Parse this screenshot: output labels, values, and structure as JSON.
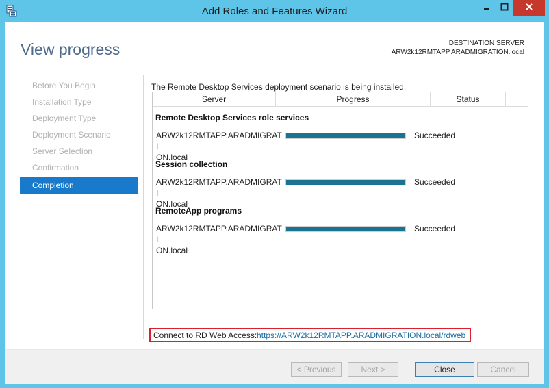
{
  "window": {
    "title": "Add Roles and Features Wizard",
    "icons": [
      "server-manager-icon",
      "minimize-icon",
      "maximize-icon",
      "close-icon"
    ]
  },
  "header": {
    "heading": "View progress",
    "destination_label": "DESTINATION SERVER",
    "destination_server": "ARW2k12RMTAPP.ARADMIGRATION.local"
  },
  "nav": {
    "steps": [
      {
        "label": "Before You Begin",
        "active": false
      },
      {
        "label": "Installation Type",
        "active": false
      },
      {
        "label": "Deployment Type",
        "active": false
      },
      {
        "label": "Deployment Scenario",
        "active": false
      },
      {
        "label": "Server Selection",
        "active": false
      },
      {
        "label": "Confirmation",
        "active": false
      },
      {
        "label": "Completion",
        "active": true
      }
    ]
  },
  "main": {
    "intro": "The Remote Desktop Services deployment scenario is being installed.",
    "columns": {
      "server": "Server",
      "progress": "Progress",
      "status": "Status"
    },
    "groups": [
      {
        "title": "Remote Desktop Services role services",
        "server_line1": "ARW2k12RMTAPP.ARADMIGRATI",
        "server_line2": "ON.local",
        "progress": 1.0,
        "status": "Succeeded"
      },
      {
        "title": "Session collection",
        "server_line1": "ARW2k12RMTAPP.ARADMIGRATI",
        "server_line2": "ON.local",
        "progress": 1.0,
        "status": "Succeeded"
      },
      {
        "title": "RemoteApp programs",
        "server_line1": "ARW2k12RMTAPP.ARADMIGRATI",
        "server_line2": "ON.local",
        "progress": 1.0,
        "status": "Succeeded"
      }
    ],
    "web_access_label": "Connect to RD Web Access:",
    "web_access_link": "https://ARW2k12RMTAPP.ARADMIGRATION.local/rdweb"
  },
  "footer": {
    "previous": "< Previous",
    "next": "Next >",
    "close": "Close",
    "cancel": "Cancel"
  },
  "colors": {
    "frame": "#5ec4e8",
    "active_step": "#1979ca",
    "progress_fill": "#1a7391",
    "highlight_box": "#d9202c",
    "link": "#1c6ea4"
  }
}
